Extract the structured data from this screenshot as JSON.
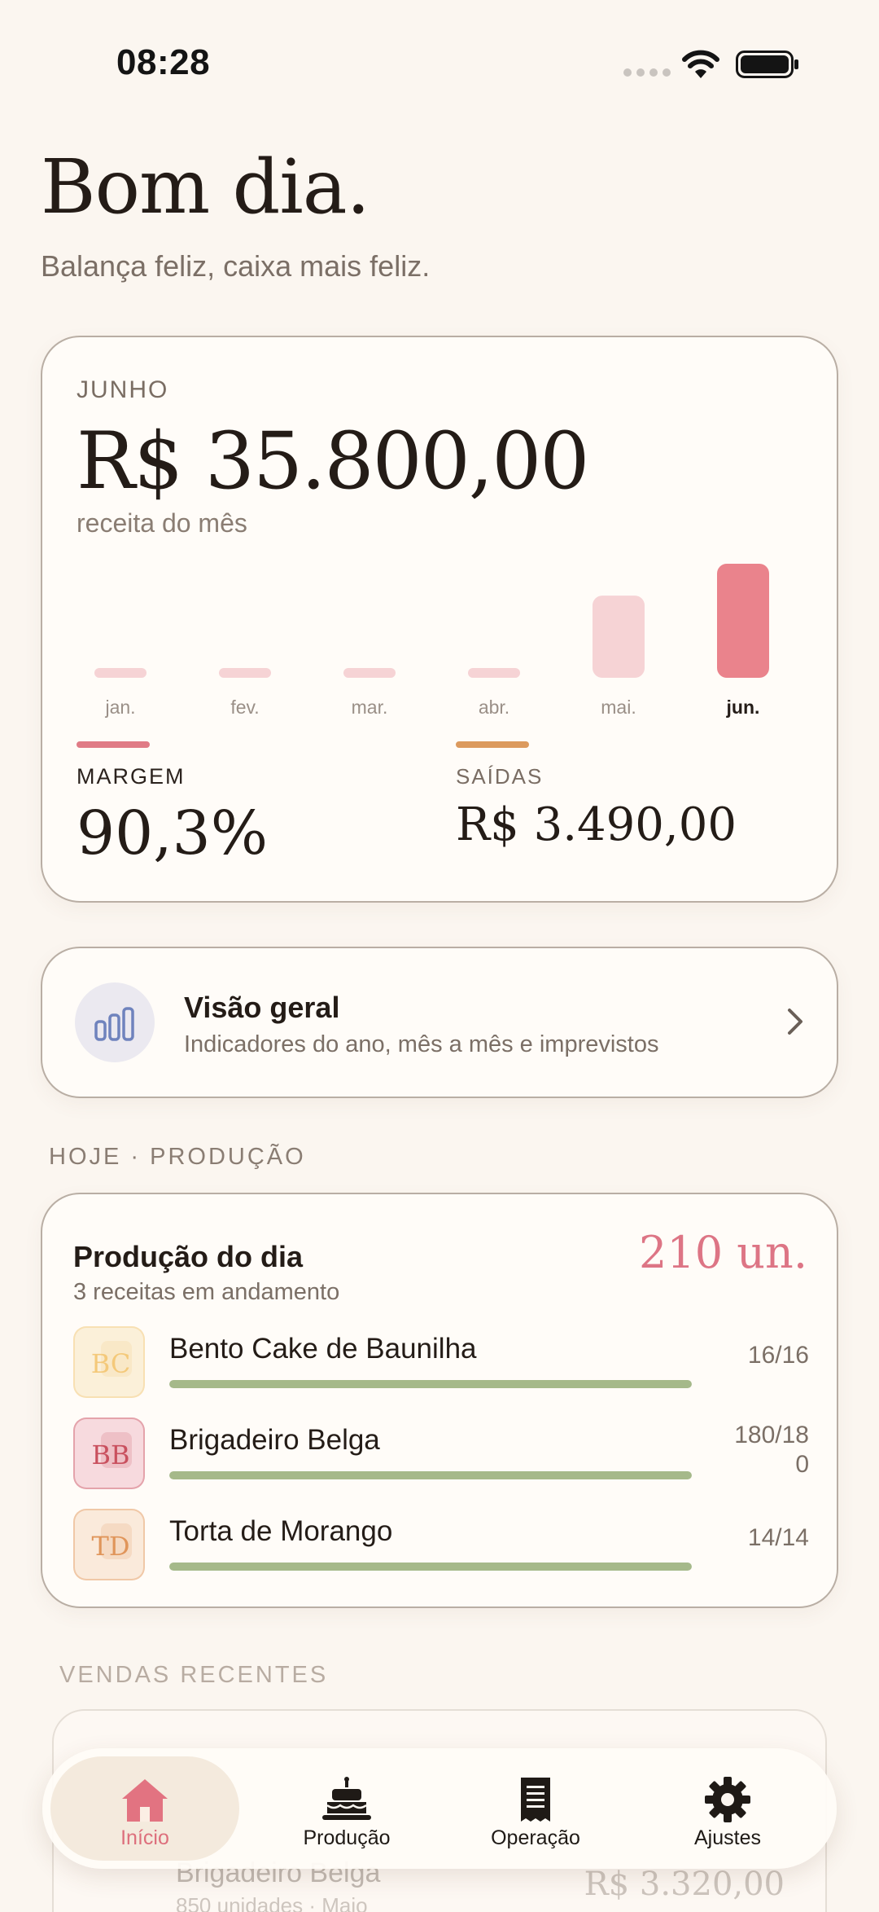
{
  "status_bar": {
    "time": "08:28"
  },
  "greeting": {
    "title": "Bom dia.",
    "subtitle": "Balança feliz, caixa mais feliz."
  },
  "revenue": {
    "month": "JUNHO",
    "value": "R$ 35.800,00",
    "caption": "receita do mês",
    "margin_label": "MARGEM",
    "margin_value": "90,3%",
    "expenses_label": "SAÍDAS",
    "expenses_value": "R$ 3.490,00",
    "margin_color": "#e07b86",
    "expenses_color": "#dc9a5e"
  },
  "chart_data": {
    "type": "bar",
    "categories": [
      "jan.",
      "fev.",
      "mar.",
      "abr.",
      "mai.",
      "jun."
    ],
    "values": [
      0,
      0,
      0,
      0,
      25800,
      35800
    ],
    "selected": "jun.",
    "ylim": [
      0,
      35800
    ],
    "colors": {
      "inactive": "#f6d3d5",
      "active": "#ea838c"
    }
  },
  "overview": {
    "icon": "bar-chart-icon",
    "title": "Visão geral",
    "subtitle": "Indicadores do ano, mês a mês e imprevistos"
  },
  "production": {
    "section_label": "HOJE · PRODUÇÃO",
    "title": "Produção do dia",
    "subtitle": "3 receitas em andamento",
    "total": "210 un.",
    "recipes": [
      {
        "initials": "BC",
        "name": "Bento Cake de Baunilha",
        "count": "16/16",
        "progress": 1.0,
        "color": "#f4c97a",
        "bg": "#fbf0d9"
      },
      {
        "initials": "BB",
        "name": "Brigadeiro Belga",
        "count": "180/180",
        "progress": 1.0,
        "color": "#c9505e",
        "bg": "#f7dade"
      },
      {
        "initials": "TD",
        "name": "Torta de Morango",
        "count": "14/14",
        "progress": 1.0,
        "color": "#e0955a",
        "bg": "#faeadb"
      }
    ]
  },
  "sales": {
    "section_label": "VENDAS RECENTES",
    "ghost_name": "Brigadeiro Belga",
    "ghost_sub": "850 unidades · Maio",
    "ghost_value": "R$ 3.320,00"
  },
  "tab_bar": {
    "tabs": [
      {
        "label": "Início",
        "icon": "home-icon",
        "active": true
      },
      {
        "label": "Produção",
        "icon": "cake-icon",
        "active": false
      },
      {
        "label": "Operação",
        "icon": "receipt-icon",
        "active": false
      },
      {
        "label": "Ajustes",
        "icon": "gear-icon",
        "active": false
      }
    ]
  }
}
